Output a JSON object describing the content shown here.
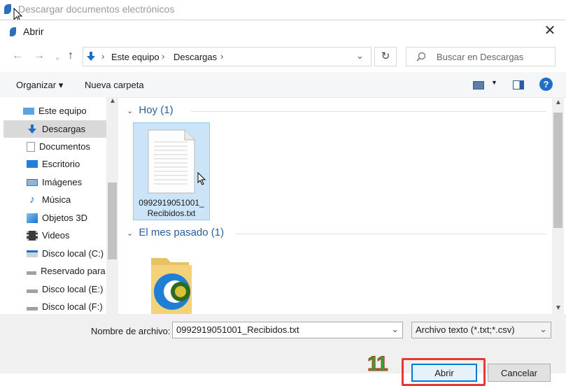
{
  "background_window": {
    "title": "Descargar documentos electrónicos"
  },
  "dialog": {
    "title": "Abrir",
    "address": [
      "Este equipo",
      "Descargas"
    ],
    "search_placeholder": "Buscar en Descargas",
    "toolbar": {
      "organize": "Organizar ▾",
      "new_folder": "Nueva carpeta",
      "help": "?"
    },
    "sidebar": [
      {
        "label": "Este equipo",
        "icon": "computer-icon"
      },
      {
        "label": "Descargas",
        "icon": "download-arrow-icon",
        "selected": true
      },
      {
        "label": "Documentos",
        "icon": "document-icon"
      },
      {
        "label": "Escritorio",
        "icon": "desktop-icon"
      },
      {
        "label": "Imágenes",
        "icon": "pictures-icon"
      },
      {
        "label": "Música",
        "icon": "music-icon"
      },
      {
        "label": "Objetos 3D",
        "icon": "cube-icon"
      },
      {
        "label": "Videos",
        "icon": "video-icon"
      },
      {
        "label": "Disco local (C:)",
        "icon": "drive-icon"
      },
      {
        "label": "Reservado para el",
        "icon": "drive-icon"
      },
      {
        "label": "Disco local (E:)",
        "icon": "drive-icon"
      },
      {
        "label": "Disco local (F:)",
        "icon": "drive-icon"
      }
    ],
    "groups": {
      "today": {
        "header": "Hoy (1)",
        "file_name": "0992919051001_\nRecibidos.txt"
      },
      "last_month": {
        "header": "El mes pasado (1)"
      }
    },
    "bottom": {
      "filename_label": "Nombre de archivo:",
      "filename_value": "0992919051001_Recibidos.txt",
      "filter_value": "Archivo texto (*.txt;*.csv)",
      "open": "Abrir",
      "cancel": "Cancelar",
      "step_marker": "11"
    }
  },
  "colors": {
    "accent": "#1f6fc9",
    "selection": "#cce4f7",
    "highlight_border": "#e53935",
    "marker": "#2ea82e"
  }
}
